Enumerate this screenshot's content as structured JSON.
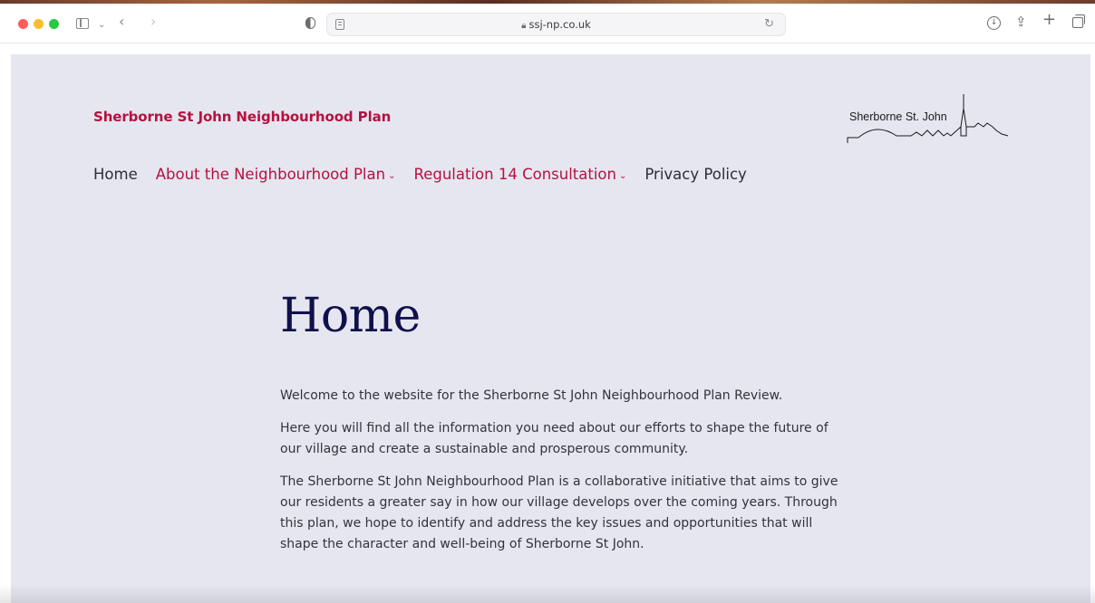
{
  "browser": {
    "url": "ssj-np.co.uk"
  },
  "site": {
    "title": "Sherborne St John Neighbourhood Plan",
    "logo_text": "Sherborne St. John"
  },
  "nav": {
    "items": [
      {
        "label": "Home",
        "has_dropdown": false,
        "accent": false
      },
      {
        "label": "About the Neighbourhood Plan",
        "has_dropdown": true,
        "accent": true
      },
      {
        "label": "Regulation 14 Consultation",
        "has_dropdown": true,
        "accent": true
      },
      {
        "label": "Privacy Policy",
        "has_dropdown": false,
        "accent": false
      }
    ]
  },
  "page": {
    "title": "Home",
    "paragraphs": [
      "Welcome to the website for the Sherborne St John Neighbourhood Plan Review.",
      "Here you will find all the information you need about our efforts to shape the future of our village and create a sustainable and prosperous community.",
      "The Sherborne St John Neighbourhood Plan is a collaborative initiative that aims to give our residents a greater say in how our village develops over the coming years. Through this plan, we hope to identify and address the key issues and opportunities that will shape the character and well-being of Sherborne St John."
    ]
  },
  "colors": {
    "accent": "#b5123f",
    "page_background": "#e6e6f0",
    "heading": "#10104a"
  },
  "icons": {
    "chevron": "chevron-down-icon",
    "lock": "lock-icon",
    "reload": "reload-icon"
  }
}
